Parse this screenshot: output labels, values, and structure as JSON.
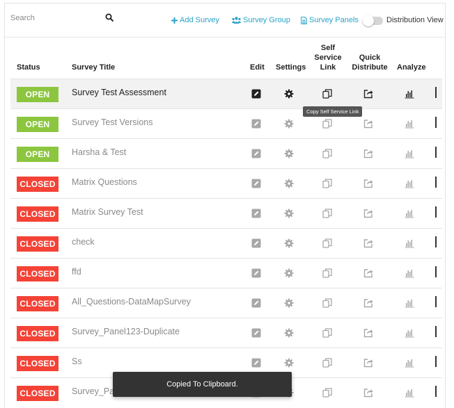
{
  "search": {
    "placeholder": "Search",
    "value": ""
  },
  "toolbar": {
    "add_survey": "Add Survey",
    "survey_group": "Survey Group",
    "survey_panels": "Survey Panels",
    "distribution_view": "Distribution View",
    "distribution_view_on": false
  },
  "columns": {
    "status": "Status",
    "title": "Survey Title",
    "edit": "Edit",
    "settings": "Settings",
    "self_service_1": "Self",
    "self_service_2": "Service",
    "self_service_3": "Link",
    "quick_1": "Quick",
    "quick_2": "Distribute",
    "analyze": "Analyze"
  },
  "surveys": [
    {
      "status": "OPEN",
      "title": "Survey Test Assessment"
    },
    {
      "status": "OPEN",
      "title": "Survey Test Versions"
    },
    {
      "status": "OPEN",
      "title": "Harsha & Test"
    },
    {
      "status": "CLOSED",
      "title": "Matrix Questions"
    },
    {
      "status": "CLOSED",
      "title": "Matrix Survey Test"
    },
    {
      "status": "CLOSED",
      "title": "check"
    },
    {
      "status": "CLOSED",
      "title": "ffd"
    },
    {
      "status": "CLOSED",
      "title": "All_Questions-DataMapSurvey"
    },
    {
      "status": "CLOSED",
      "title": "Survey_Panel123-Duplicate"
    },
    {
      "status": "CLOSED",
      "title": "Ss"
    },
    {
      "status": "CLOSED",
      "title": "Survey_Pa"
    }
  ],
  "tooltip": "Copy Self Service Link",
  "toast": "Copied To Clipboard.",
  "colors": {
    "accent": "#29a3c9",
    "open": "#8cc63f",
    "closed": "#f44336"
  },
  "icons": [
    "search-icon",
    "plus-icon",
    "users-icon",
    "document-icon",
    "edit-icon",
    "gear-icon",
    "copy-icon",
    "share-icon",
    "bar-chart-icon"
  ]
}
